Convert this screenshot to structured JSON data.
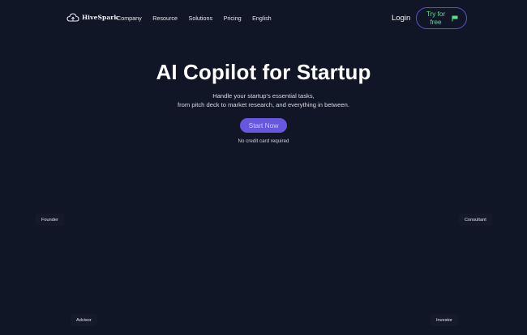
{
  "nav": {
    "logo_text": "HiveSpark",
    "menu": [
      "Company",
      "Resource",
      "Solutions",
      "Pricing",
      "English"
    ],
    "login_label": "Login",
    "try_label": "Try for free"
  },
  "hero": {
    "title": "AI Copilot for Startup",
    "subtitle_line1": "Handle your startup's essential tasks,",
    "subtitle_line2": "from pitch deck to market research, and everything in between.",
    "cta_label": "Start Now",
    "note": "No credit card required"
  },
  "personas": {
    "founder": "Founder",
    "consultant": "Consultant",
    "advisor": "Advisor",
    "investor": "Investor"
  },
  "colors": {
    "background": "#111627",
    "accent": "#6757de",
    "try_text": "#57e38b"
  },
  "icons": [
    "cloud-logo-icon",
    "flag-icon"
  ]
}
